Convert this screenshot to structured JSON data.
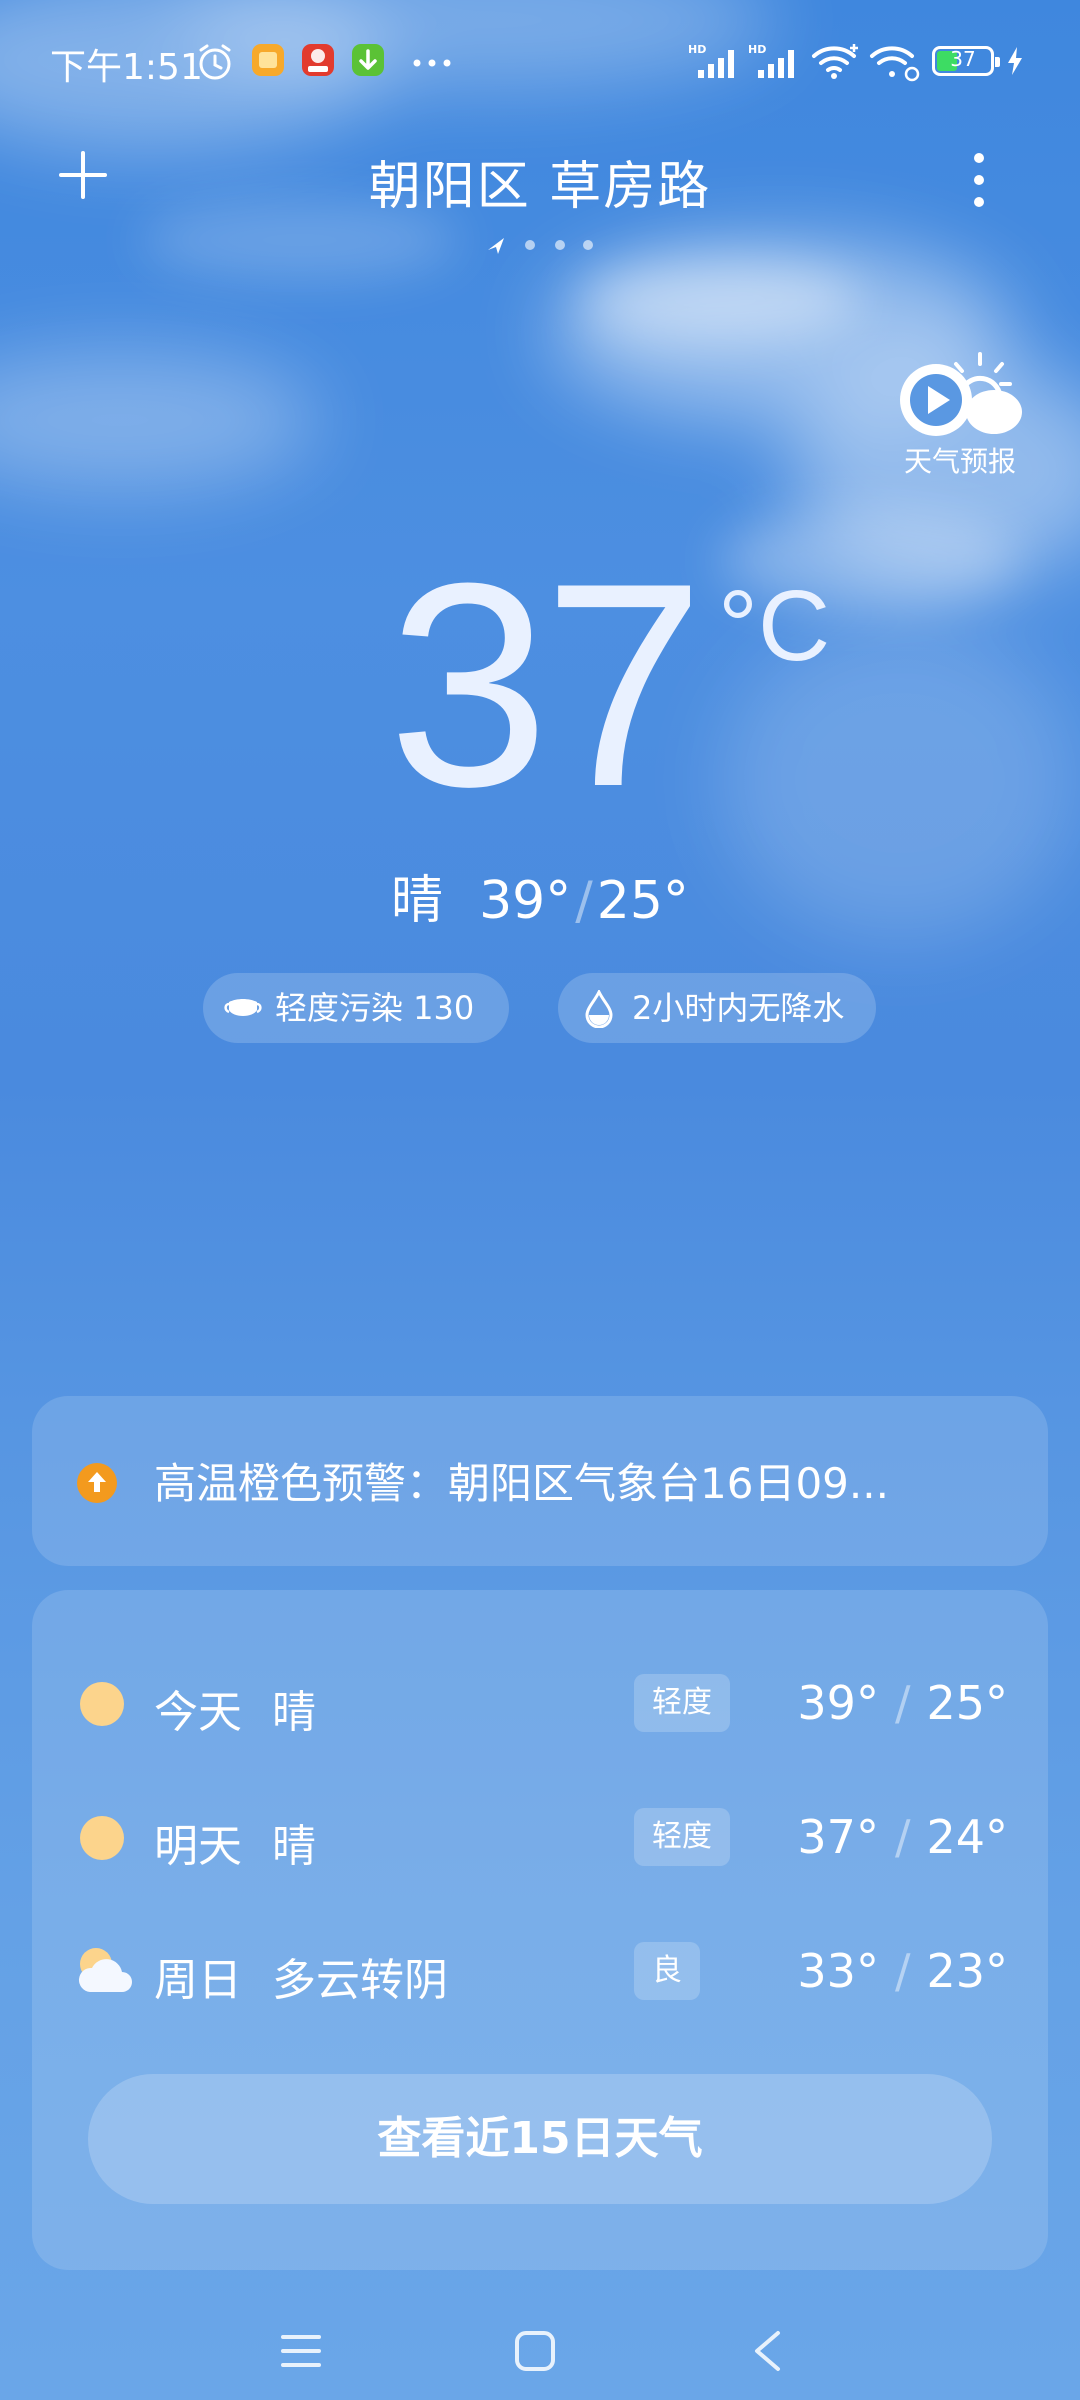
{
  "status_bar": {
    "time": "下午1:51",
    "battery": "37",
    "notification_icons": [
      "alarm-icon",
      "notes-app-icon",
      "shopping-618-app-icon",
      "download-app-icon",
      "more-dots-icon"
    ],
    "right_icons": [
      "hd-signal-icon",
      "hd-signal-icon",
      "wifi-icon",
      "wifi-hotspot-icon",
      "battery-icon",
      "charging-icon"
    ]
  },
  "header": {
    "location": "朝阳区 草房路",
    "page_count": 4,
    "current_page": 0
  },
  "forecast_video": {
    "label": "天气预报"
  },
  "current": {
    "temp": "37",
    "unit": "°C",
    "condition": "晴",
    "high": "39°",
    "low": "25°",
    "separator": "/"
  },
  "chips": {
    "aqi": "轻度污染 130",
    "precip": "2小时内无降水"
  },
  "alert": {
    "text": "高温橙色预警：朝阳区气象台16日09...",
    "color": "#f39a1e"
  },
  "forecast": [
    {
      "day": "今天",
      "condition": "晴",
      "aqi": "轻度",
      "high": "39°",
      "low": "25°",
      "icon": "sun-icon"
    },
    {
      "day": "明天",
      "condition": "晴",
      "aqi": "轻度",
      "high": "37°",
      "low": "24°",
      "icon": "sun-icon"
    },
    {
      "day": "周日",
      "condition": "多云转阴",
      "aqi": "良",
      "high": "33°",
      "low": "23°",
      "icon": "partly-cloudy-icon"
    }
  ],
  "forecast_button": "查看近15日天气",
  "colors": {
    "sun": "#fcd48c",
    "battery_fill": "#3ddc63",
    "background_top": "#3f87de",
    "background_bottom": "#6aa6e8"
  }
}
